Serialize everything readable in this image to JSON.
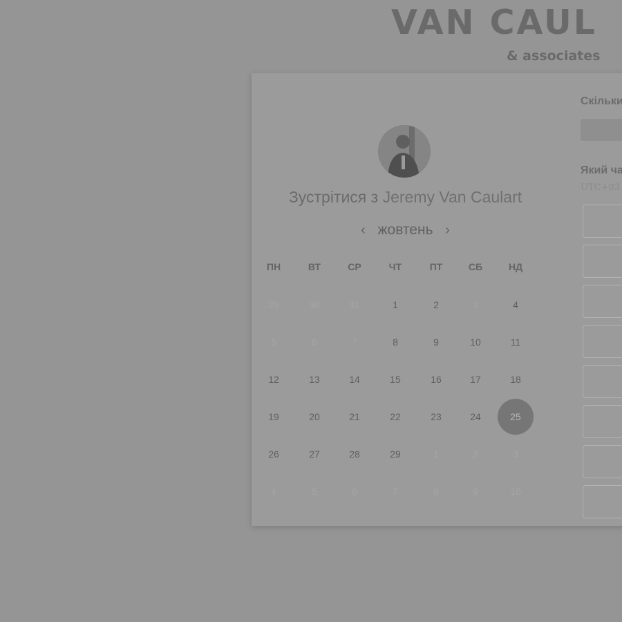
{
  "brand": {
    "title": "VAN CAUL",
    "subtitle": "& associates"
  },
  "scheduler": {
    "title_prefix": "Зустрітися з",
    "host_name": "Jeremy Van Caulart",
    "month": "жовтень",
    "prev_icon": "chevron-left-icon",
    "next_icon": "chevron-right-icon",
    "weekdays": [
      "ПН",
      "ВТ",
      "СР",
      "ЧТ",
      "ПТ",
      "СБ",
      "НД"
    ],
    "days": [
      {
        "label": "29",
        "muted": true
      },
      {
        "label": "30",
        "muted": true
      },
      {
        "label": "31",
        "muted": true
      },
      {
        "label": "1"
      },
      {
        "label": "2"
      },
      {
        "label": "3",
        "muted": true
      },
      {
        "label": "4"
      },
      {
        "label": "5",
        "muted": true
      },
      {
        "label": "6",
        "muted": true
      },
      {
        "label": "7",
        "muted": true
      },
      {
        "label": "8"
      },
      {
        "label": "9"
      },
      {
        "label": "10"
      },
      {
        "label": "11"
      },
      {
        "label": "12"
      },
      {
        "label": "13"
      },
      {
        "label": "14"
      },
      {
        "label": "15"
      },
      {
        "label": "16"
      },
      {
        "label": "17"
      },
      {
        "label": "18"
      },
      {
        "label": "19"
      },
      {
        "label": "20"
      },
      {
        "label": "21"
      },
      {
        "label": "22"
      },
      {
        "label": "23"
      },
      {
        "label": "24"
      },
      {
        "label": "25",
        "selected": true
      },
      {
        "label": "26"
      },
      {
        "label": "27"
      },
      {
        "label": "28"
      },
      {
        "label": "29"
      },
      {
        "label": "1",
        "muted": true
      },
      {
        "label": "2",
        "muted": true
      },
      {
        "label": "3",
        "muted": true
      },
      {
        "label": "4",
        "muted": true
      },
      {
        "label": "5",
        "muted": true
      },
      {
        "label": "6",
        "muted": true
      },
      {
        "label": "7",
        "muted": true
      },
      {
        "label": "8",
        "muted": true
      },
      {
        "label": "9",
        "muted": true
      },
      {
        "label": "10",
        "muted": true
      }
    ]
  },
  "right_panel": {
    "duration_label": "Скільки",
    "time_label": "Який ча",
    "timezone": "UTC+03"
  }
}
